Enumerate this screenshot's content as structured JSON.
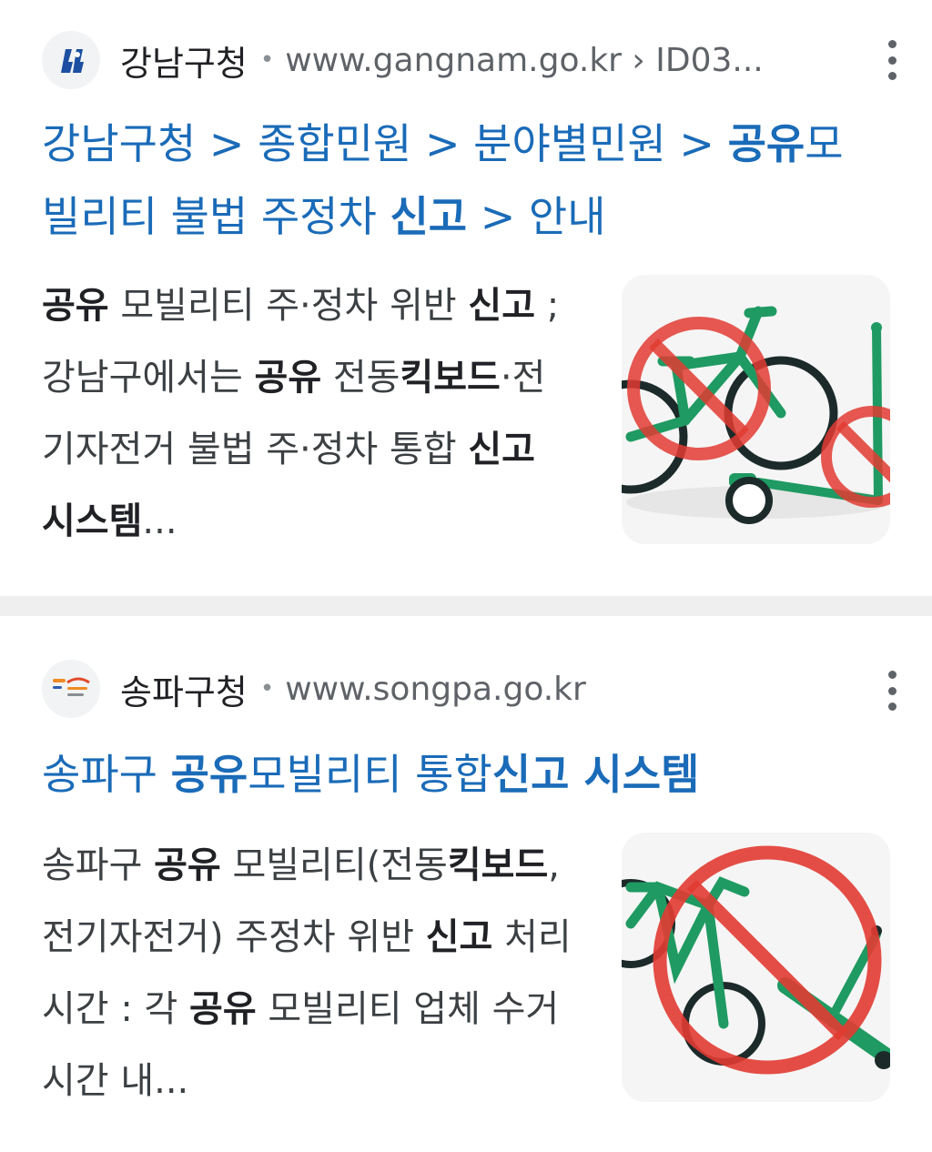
{
  "results": [
    {
      "site_name": "강남구청",
      "url": "www.gangnam.go.kr › ID03...",
      "title": {
        "bc1": "강남구청",
        "bc2": "종합민원",
        "bc3": "분야별민원",
        "bc4_b1": "공유",
        "bc4_t1": "모빌리티 불법 주정차 ",
        "bc4_b2": "신고",
        "bc5": "안내",
        "sep": " > "
      },
      "snippet": {
        "b1": "공유",
        "t1": " 모빌리티 주·정차 위반 ",
        "b2": "신고",
        "t2": " ; 강남구에서는 ",
        "b3": "공유",
        "t3": " 전동",
        "b4": "킥보드",
        "t4": "·전기자전거 불법 주·정차 통합 ",
        "b5": "신고 시스템",
        "t5": "..."
      }
    },
    {
      "site_name": "송파구청",
      "url": "www.songpa.go.kr",
      "title": {
        "t1": "송파구 ",
        "b1": "공유",
        "t2": "모빌리티 통합",
        "b2": "신고 시스템"
      },
      "snippet": {
        "t1": "송파구 ",
        "b1": "공유",
        "t2": " 모빌리티(전동",
        "b2": "킥보드",
        "t3": ", 전기자전거) 주정차 위반 ",
        "b3": "신고",
        "t4": " 처리시간 : 각 ",
        "b4": "공유",
        "t5": " 모빌리티 업체 수거시간 내..."
      }
    }
  ],
  "icons": {
    "kebab": "more-vert-icon",
    "favicon1": "gangnam-logo-icon",
    "favicon2": "songpa-logo-icon"
  },
  "colors": {
    "link": "#1a6bb8",
    "prohibit_red": "#e23b32",
    "bike_green": "#1f9a62"
  }
}
